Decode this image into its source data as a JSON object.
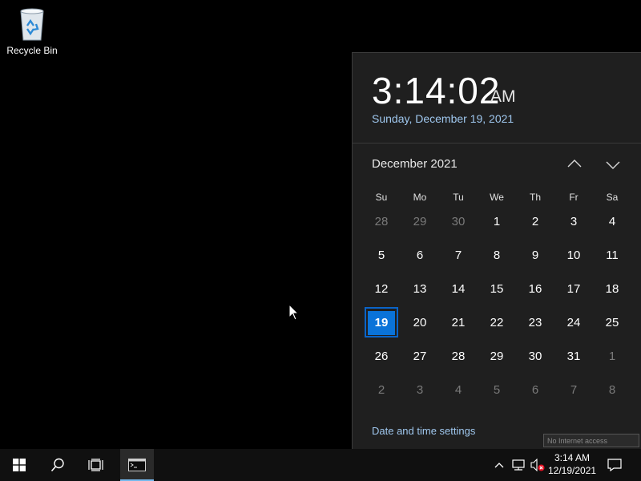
{
  "desktop": {
    "recycle_bin_label": "Recycle Bin"
  },
  "clock_flyout": {
    "time": "3:14:02",
    "ampm": "AM",
    "full_date": "Sunday, December 19, 2021",
    "month_title": "December 2021",
    "days_of_week": [
      "Su",
      "Mo",
      "Tu",
      "We",
      "Th",
      "Fr",
      "Sa"
    ],
    "weeks": [
      [
        {
          "d": "28",
          "other": true
        },
        {
          "d": "29",
          "other": true
        },
        {
          "d": "30",
          "other": true
        },
        {
          "d": "1"
        },
        {
          "d": "2"
        },
        {
          "d": "3"
        },
        {
          "d": "4"
        }
      ],
      [
        {
          "d": "5"
        },
        {
          "d": "6"
        },
        {
          "d": "7"
        },
        {
          "d": "8"
        },
        {
          "d": "9"
        },
        {
          "d": "10"
        },
        {
          "d": "11"
        }
      ],
      [
        {
          "d": "12"
        },
        {
          "d": "13"
        },
        {
          "d": "14"
        },
        {
          "d": "15"
        },
        {
          "d": "16"
        },
        {
          "d": "17"
        },
        {
          "d": "18"
        }
      ],
      [
        {
          "d": "19",
          "today": true
        },
        {
          "d": "20"
        },
        {
          "d": "21"
        },
        {
          "d": "22"
        },
        {
          "d": "23"
        },
        {
          "d": "24"
        },
        {
          "d": "25"
        }
      ],
      [
        {
          "d": "26"
        },
        {
          "d": "27"
        },
        {
          "d": "28"
        },
        {
          "d": "29"
        },
        {
          "d": "30"
        },
        {
          "d": "31"
        },
        {
          "d": "1",
          "other": true
        }
      ],
      [
        {
          "d": "2",
          "other": true
        },
        {
          "d": "3",
          "other": true
        },
        {
          "d": "4",
          "other": true
        },
        {
          "d": "5",
          "other": true
        },
        {
          "d": "6",
          "other": true
        },
        {
          "d": "7",
          "other": true
        },
        {
          "d": "8",
          "other": true
        }
      ]
    ],
    "settings_link": "Date and time settings",
    "tooltip": "No Internet access"
  },
  "taskbar": {
    "tray_time": "3:14 AM",
    "tray_date": "12/19/2021"
  },
  "colors": {
    "accent": "#0a73d9",
    "link": "#9fc7ee",
    "flyout_bg": "#1f1f1f",
    "taskbar_bg": "#101010"
  },
  "icons": [
    "recycle-bin-icon",
    "windows-logo-icon",
    "search-icon",
    "task-view-icon",
    "command-prompt-icon",
    "chevron-up-icon",
    "chevron-down-icon",
    "network-icon",
    "volume-muted-icon",
    "notification-icon"
  ]
}
